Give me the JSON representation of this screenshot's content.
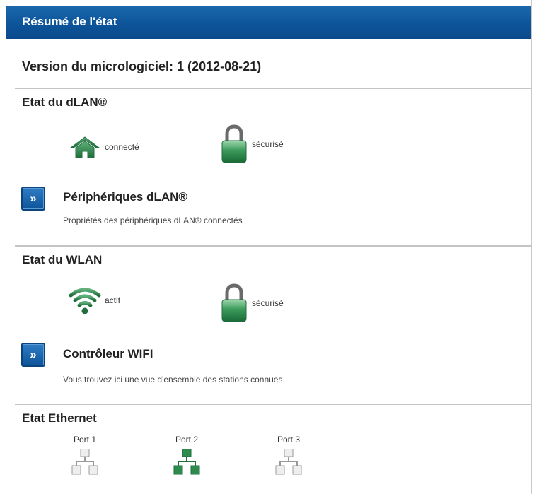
{
  "header": {
    "title": "Résumé de l'état"
  },
  "firmware": {
    "text": "Version du micrologiciel: 1 (2012-08-21)"
  },
  "dlan": {
    "section_title": "Etat du dLAN®",
    "connection_label": "connecté",
    "security_label": "sécurisé",
    "nav": {
      "button_label": "»",
      "title": "Périphériques dLAN®",
      "description": "Propriétés des périphériques dLAN® connectés"
    }
  },
  "wlan": {
    "section_title": "Etat du WLAN",
    "status_label": "actif",
    "security_label": "sécurisé",
    "nav": {
      "button_label": "»",
      "title": "Contrôleur WIFI",
      "description": "Vous trouvez ici une vue d'ensemble des stations connues."
    }
  },
  "ethernet": {
    "section_title": "Etat Ethernet",
    "ports": [
      {
        "label": "Port 1",
        "active": false
      },
      {
        "label": "Port 2",
        "active": true
      },
      {
        "label": "Port 3",
        "active": false
      }
    ]
  },
  "colors": {
    "header_blue": "#0d5499",
    "status_green": "#2f8a4e",
    "inactive_gray": "#c8c8c8"
  }
}
